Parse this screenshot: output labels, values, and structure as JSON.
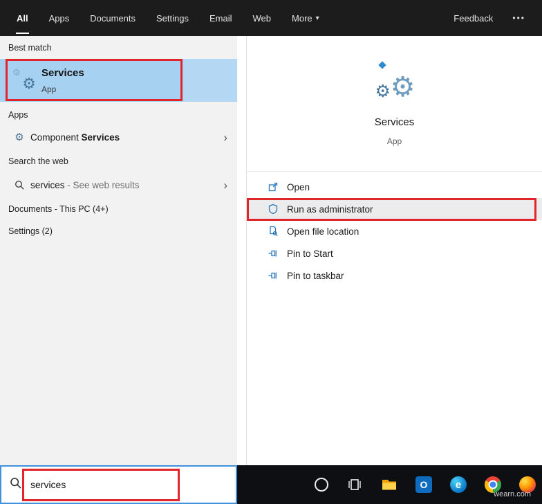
{
  "topbar": {
    "tabs": [
      {
        "label": "All",
        "active": true
      },
      {
        "label": "Apps",
        "active": false
      },
      {
        "label": "Documents",
        "active": false
      },
      {
        "label": "Settings",
        "active": false
      },
      {
        "label": "Email",
        "active": false
      },
      {
        "label": "Web",
        "active": false
      },
      {
        "label": "More",
        "active": false,
        "has_dropdown": true
      }
    ],
    "feedback_label": "Feedback",
    "overflow_label": "•••"
  },
  "left_panel": {
    "best_match_header": "Best match",
    "best_match": {
      "title": "Services",
      "subtitle": "App"
    },
    "apps_header": "Apps",
    "component_services": {
      "regular": "Component ",
      "bold": "Services"
    },
    "web_header": "Search the web",
    "web_result": {
      "term": "services",
      "suffix": " - See web results"
    },
    "documents_header": "Documents - This PC (4+)",
    "settings_header": "Settings (2)"
  },
  "preview": {
    "title": "Services",
    "subtitle": "App",
    "actions": [
      {
        "label": "Open",
        "icon": "open-icon"
      },
      {
        "label": "Run as administrator",
        "icon": "admin-shield-icon",
        "highlighted": true
      },
      {
        "label": "Open file location",
        "icon": "file-location-icon"
      },
      {
        "label": "Pin to Start",
        "icon": "pin-icon"
      },
      {
        "label": "Pin to taskbar",
        "icon": "pin-icon"
      }
    ]
  },
  "search_box": {
    "value": "services"
  },
  "taskbar": {
    "icons": [
      "cortana-icon",
      "task-view-icon",
      "file-explorer-icon",
      "outlook-icon",
      "edge-icon",
      "chrome-icon",
      "firefox-icon"
    ],
    "outlook_letter": "O",
    "edge_letter": "e"
  },
  "watermark": "wearn.com",
  "glyphs": {
    "gear": "⚙",
    "chevron": "›",
    "dropdown": "▾"
  },
  "colors": {
    "topbar_bg": "#1c1c1c",
    "left_bg": "#f2f2f2",
    "selection_blue": "#a7d1f1",
    "annotation_red": "#e2242b",
    "accent_blue": "#2a7ab9",
    "search_border_blue": "#4191dd",
    "taskbar_bg": "#0d0f12"
  }
}
